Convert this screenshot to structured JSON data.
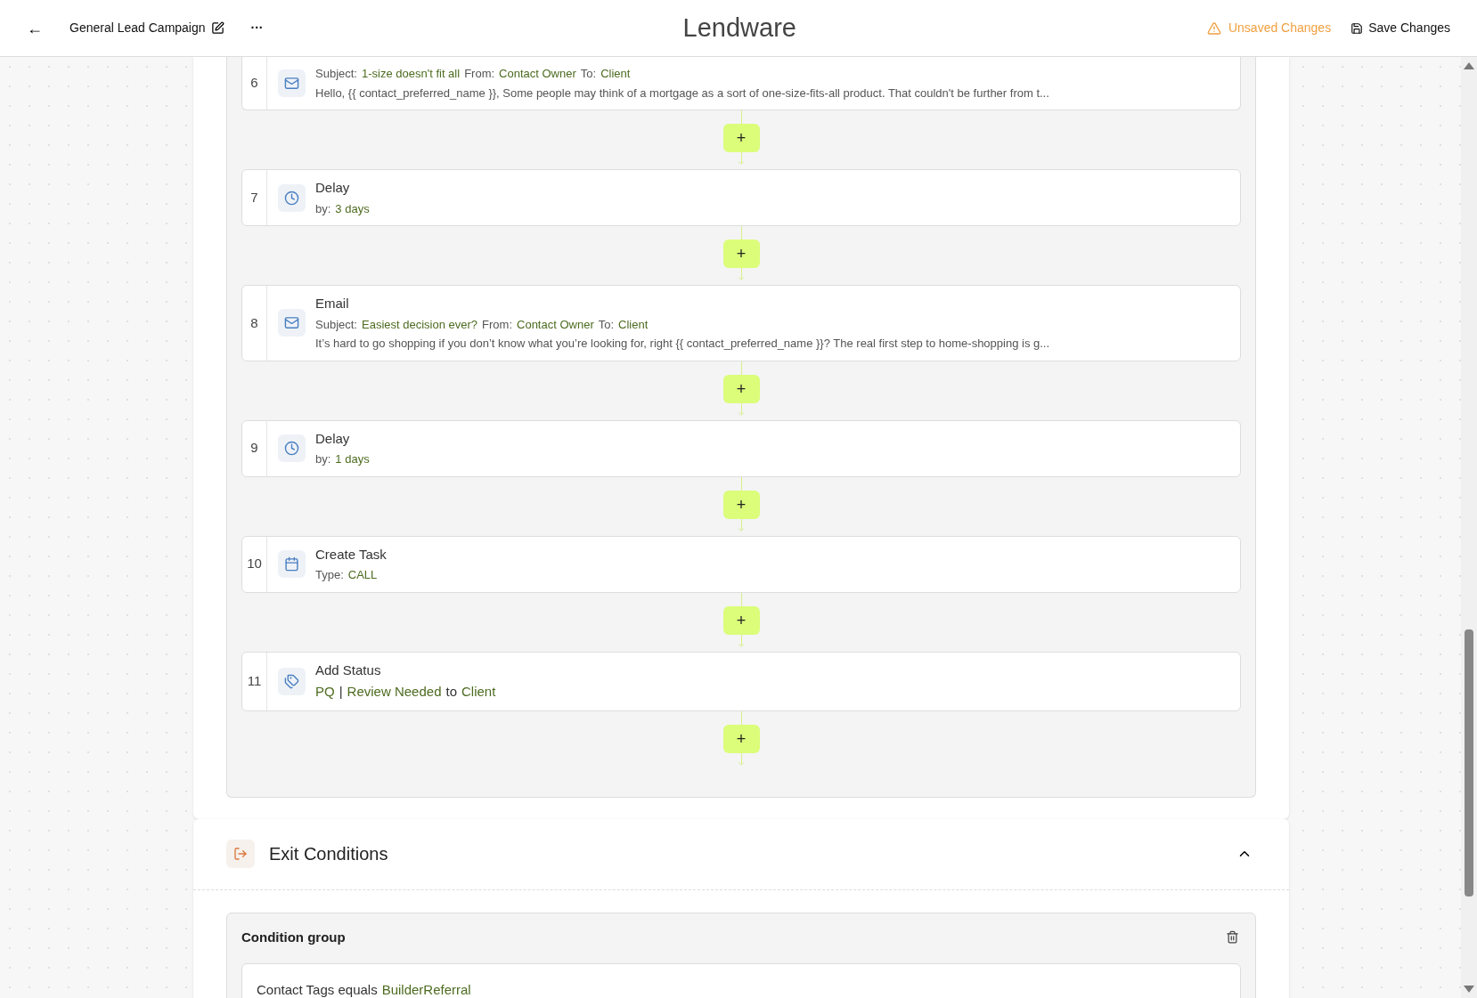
{
  "header": {
    "back": "←",
    "title": "General Lead Campaign",
    "more": "···",
    "logo": "Lendware",
    "unsaved": "Unsaved Changes",
    "save": "Save Changes"
  },
  "steps": [
    {
      "number": "6",
      "kind": "email",
      "lines": [
        [
          {
            "text": "Subject:",
            "accent": false
          },
          {
            "text": "1-size doesn't fit all",
            "accent": true
          },
          {
            "text": "From:",
            "accent": false
          },
          {
            "text": "Contact Owner",
            "accent": true
          },
          {
            "text": "To:",
            "accent": false
          },
          {
            "text": "Client",
            "accent": true
          }
        ],
        [
          {
            "text": "Hello, {{ contact_preferred_name }}, Some people may think of a mortgage as a sort of one-size-fits-all product. That couldn't be further from t...",
            "accent": false
          }
        ]
      ]
    },
    {
      "number": "7",
      "kind": "delay",
      "title": "Delay",
      "lines": [
        [
          {
            "text": "by:",
            "accent": false
          },
          {
            "text": "3 days",
            "accent": true
          }
        ]
      ]
    },
    {
      "number": "8",
      "kind": "email",
      "title": "Email",
      "lines": [
        [
          {
            "text": "Subject:",
            "accent": false
          },
          {
            "text": "Easiest decision ever?",
            "accent": true
          },
          {
            "text": "From:",
            "accent": false
          },
          {
            "text": "Contact Owner",
            "accent": true
          },
          {
            "text": "To:",
            "accent": false
          },
          {
            "text": "Client",
            "accent": true
          }
        ],
        [
          {
            "text": "It’s hard to go shopping if you don’t know what you’re looking for, right {{ contact_preferred_name }}? The real first step to home-shopping is g...",
            "accent": false
          }
        ]
      ]
    },
    {
      "number": "9",
      "kind": "delay",
      "title": "Delay",
      "lines": [
        [
          {
            "text": "by:",
            "accent": false
          },
          {
            "text": "1 days",
            "accent": true
          }
        ]
      ]
    },
    {
      "number": "10",
      "kind": "task",
      "title": "Create Task",
      "lines": [
        [
          {
            "text": "Type:",
            "accent": false
          },
          {
            "text": "CALL",
            "accent": true
          }
        ]
      ]
    },
    {
      "number": "11",
      "kind": "status",
      "title": "Add Status",
      "lines": [
        [
          {
            "text": "PQ",
            "accent": true
          },
          {
            "text": "|",
            "accent": false
          },
          {
            "text": "Review Needed",
            "accent": true
          },
          {
            "text": "to",
            "accent": false
          },
          {
            "text": "Client",
            "accent": true
          }
        ]
      ]
    }
  ],
  "add_button": "+",
  "exit": {
    "title": "Exit Conditions",
    "expanded": true,
    "group": {
      "title": "Condition group",
      "condition": [
        {
          "text": "Contact Tags equals",
          "accent": false
        },
        {
          "text": "BuilderReferral",
          "accent": true
        }
      ]
    }
  }
}
